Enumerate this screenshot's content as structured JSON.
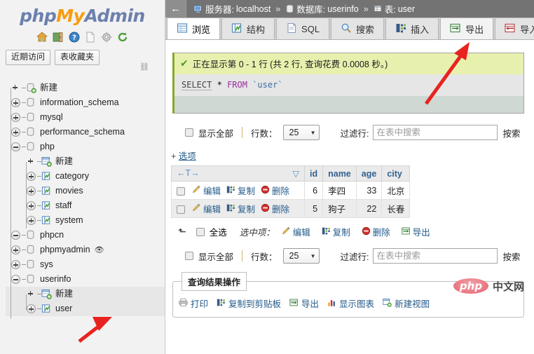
{
  "sidebar": {
    "logo": {
      "php": "php",
      "my": "My",
      "admin": "Admin"
    },
    "icons": [
      {
        "name": "home-icon",
        "title": "主页"
      },
      {
        "name": "logout-icon",
        "title": "退出"
      },
      {
        "name": "help-icon",
        "title": "帮助"
      },
      {
        "name": "docs-icon",
        "title": "文档"
      },
      {
        "name": "settings-gear-icon",
        "title": "设置"
      },
      {
        "name": "refresh-icon",
        "title": "重新加载"
      }
    ],
    "buttons": [
      {
        "name": "recent-tables-button",
        "label": "近期访问"
      },
      {
        "name": "favorite-tables-button",
        "label": "表收藏夹"
      }
    ],
    "chain_icon": "⛓",
    "tree": [
      {
        "label": "新建",
        "level": 0,
        "toggle": "none",
        "icon": "db-new-icon",
        "selected": false
      },
      {
        "label": "information_schema",
        "level": 0,
        "toggle": "plus",
        "icon": "db-icon",
        "selected": false
      },
      {
        "label": "mysql",
        "level": 0,
        "toggle": "plus",
        "icon": "db-icon",
        "selected": false
      },
      {
        "label": "performance_schema",
        "level": 0,
        "toggle": "plus",
        "icon": "db-icon",
        "selected": false
      },
      {
        "label": "php",
        "level": 0,
        "toggle": "minus",
        "icon": "db-icon",
        "selected": false
      },
      {
        "label": "新建",
        "level": 1,
        "toggle": "none",
        "icon": "table-new-icon",
        "selected": false
      },
      {
        "label": "category",
        "level": 1,
        "toggle": "plus",
        "icon": "table-icon",
        "selected": false
      },
      {
        "label": "movies",
        "level": 1,
        "toggle": "plus",
        "icon": "table-icon",
        "selected": false
      },
      {
        "label": "staff",
        "level": 1,
        "toggle": "plus",
        "icon": "table-icon",
        "selected": false
      },
      {
        "label": "system",
        "level": 1,
        "toggle": "plus",
        "icon": "table-icon",
        "selected": false
      },
      {
        "label": "phpcn",
        "level": 0,
        "toggle": "minus",
        "icon": "db-icon",
        "selected": false
      },
      {
        "label": "phpmyadmin",
        "level": 0,
        "toggle": "plus",
        "icon": "db-icon",
        "selected": false,
        "eye": "👁"
      },
      {
        "label": "sys",
        "level": 0,
        "toggle": "plus",
        "icon": "db-icon",
        "selected": false
      },
      {
        "label": "userinfo",
        "level": 0,
        "toggle": "minus",
        "icon": "db-icon",
        "selected": false
      },
      {
        "label": "新建",
        "level": 1,
        "toggle": "none",
        "icon": "table-new-icon",
        "selected": true
      },
      {
        "label": "user",
        "level": 1,
        "toggle": "plus",
        "icon": "table-icon",
        "selected": true
      }
    ]
  },
  "breadcrumb": {
    "back_arrow": "←",
    "server_label": "服务器:",
    "server_value": "localhost",
    "db_label": "数据库:",
    "db_value": "userinfo",
    "table_label": "表:",
    "table_value": "user",
    "separator": "»"
  },
  "tabs": [
    {
      "label": "浏览",
      "icon": "browse-icon",
      "state": "active"
    },
    {
      "label": "结构",
      "icon": "structure-icon",
      "state": "normal"
    },
    {
      "label": "SQL",
      "icon": "sql-icon",
      "state": "normal"
    },
    {
      "label": "搜索",
      "icon": "search-icon",
      "state": "normal"
    },
    {
      "label": "插入",
      "icon": "insert-icon",
      "state": "normal"
    },
    {
      "label": "导出",
      "icon": "export-icon",
      "state": "hover"
    },
    {
      "label": "导入",
      "icon": "import-icon",
      "state": "normal"
    }
  ],
  "message": {
    "check_icon": "✔",
    "text": "正在显示第 0 - 1 行 (共 2 行, 查询花费 0.0008 秒。)",
    "sql": {
      "kw1": "SELECT",
      "star": "*",
      "kw2": "FROM",
      "table": "`user`"
    }
  },
  "controls_top": {
    "show_all_label": "显示全部",
    "rows_label": "行数：",
    "rows_value": "25",
    "filter_label": "过滤行:",
    "filter_placeholder": "在表中搜索",
    "filter_value": "",
    "cut_text": "按索"
  },
  "options_link": {
    "plus": "+",
    "label": "选项"
  },
  "results": {
    "sort_header": "←T→",
    "sort_caret": "▽",
    "columns": [
      "id",
      "name",
      "age",
      "city"
    ],
    "row_actions": [
      {
        "label": "编辑",
        "icon": "edit-pencil-icon"
      },
      {
        "label": "复制",
        "icon": "copy-icon"
      },
      {
        "label": "删除",
        "icon": "delete-icon"
      }
    ],
    "rows": [
      {
        "id": "6",
        "name": "李四",
        "age": "33",
        "city": "北京"
      },
      {
        "id": "5",
        "name": "狗子",
        "age": "22",
        "city": "长春"
      }
    ]
  },
  "bulk_bar": {
    "arrow_icon": "⬑",
    "select_all_label": "全选",
    "with_selected_label": "选中项：",
    "actions": [
      {
        "label": "编辑",
        "icon": "edit-pencil-icon"
      },
      {
        "label": "复制",
        "icon": "copy-icon"
      },
      {
        "label": "删除",
        "icon": "delete-icon"
      },
      {
        "label": "导出",
        "icon": "export-icon"
      }
    ]
  },
  "controls_bottom": {
    "show_all_label": "显示全部",
    "rows_label": "行数：",
    "rows_value": "25",
    "filter_label": "过滤行:",
    "filter_placeholder": "在表中搜索",
    "filter_value": "",
    "cut_text": "按索"
  },
  "query_results": {
    "legend": "查询结果操作",
    "links": [
      {
        "label": "打印",
        "icon": "print-icon"
      },
      {
        "label": "复制到剪贴板",
        "icon": "copy-icon"
      },
      {
        "label": "导出",
        "icon": "export-icon"
      },
      {
        "label": "显示图表",
        "icon": "chart-icon"
      },
      {
        "label": "新建视图",
        "icon": "new-view-icon"
      }
    ]
  },
  "watermark": {
    "php": "php",
    "text": "中文网"
  },
  "colors": {
    "accent_link": "#235a8a",
    "success_bg": "#e8f0ae",
    "success_border": "#88a82a",
    "breadcrumb_bg": "#737373",
    "tabbar_bg": "#cfcfcf",
    "arrow_red": "#e8231f"
  }
}
